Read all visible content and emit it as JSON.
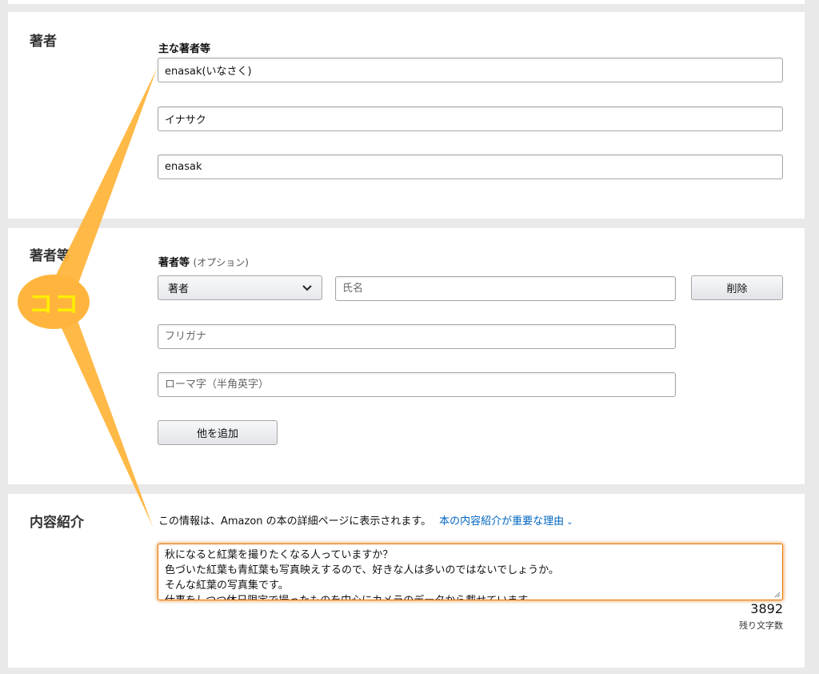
{
  "author_section": {
    "title": "著者",
    "label": "主な著者等",
    "name_value": "enasak(いなさく)",
    "kana_value": "イナサク",
    "roman_value": "enasak"
  },
  "contributor_section": {
    "title": "著者等",
    "label": "著者等",
    "label_optional": "(オプション)",
    "role_selected": "著者",
    "name_placeholder": "氏名",
    "delete_label": "削除",
    "kana_placeholder": "フリガナ",
    "roman_placeholder": "ローマ字（半角英字）",
    "add_label": "他を追加"
  },
  "description_section": {
    "title": "内容紹介",
    "info_text": "この情報は、Amazon の本の詳細ページに表示されます。",
    "info_link": "本の内容紹介が重要な理由",
    "lines": [
      "秋になると紅葉を撮りたくなる人っていますか？",
      "色づいた紅葉も青紅葉も写真映えするので、好きな人は多いのではないでしょうか。",
      "そんな紅葉の写真集です。",
      "仕事をしつつ休日限定で撮ったものを中心にカメラのデータから載せています。"
    ],
    "remaining_count": "3892",
    "remaining_label": "残り文字数"
  },
  "callout": {
    "text": "ココ",
    "color": "#ffb53d",
    "text_color": "#ffee00"
  },
  "colors": {
    "link": "#0066c0",
    "focus_border": "#e77600"
  }
}
